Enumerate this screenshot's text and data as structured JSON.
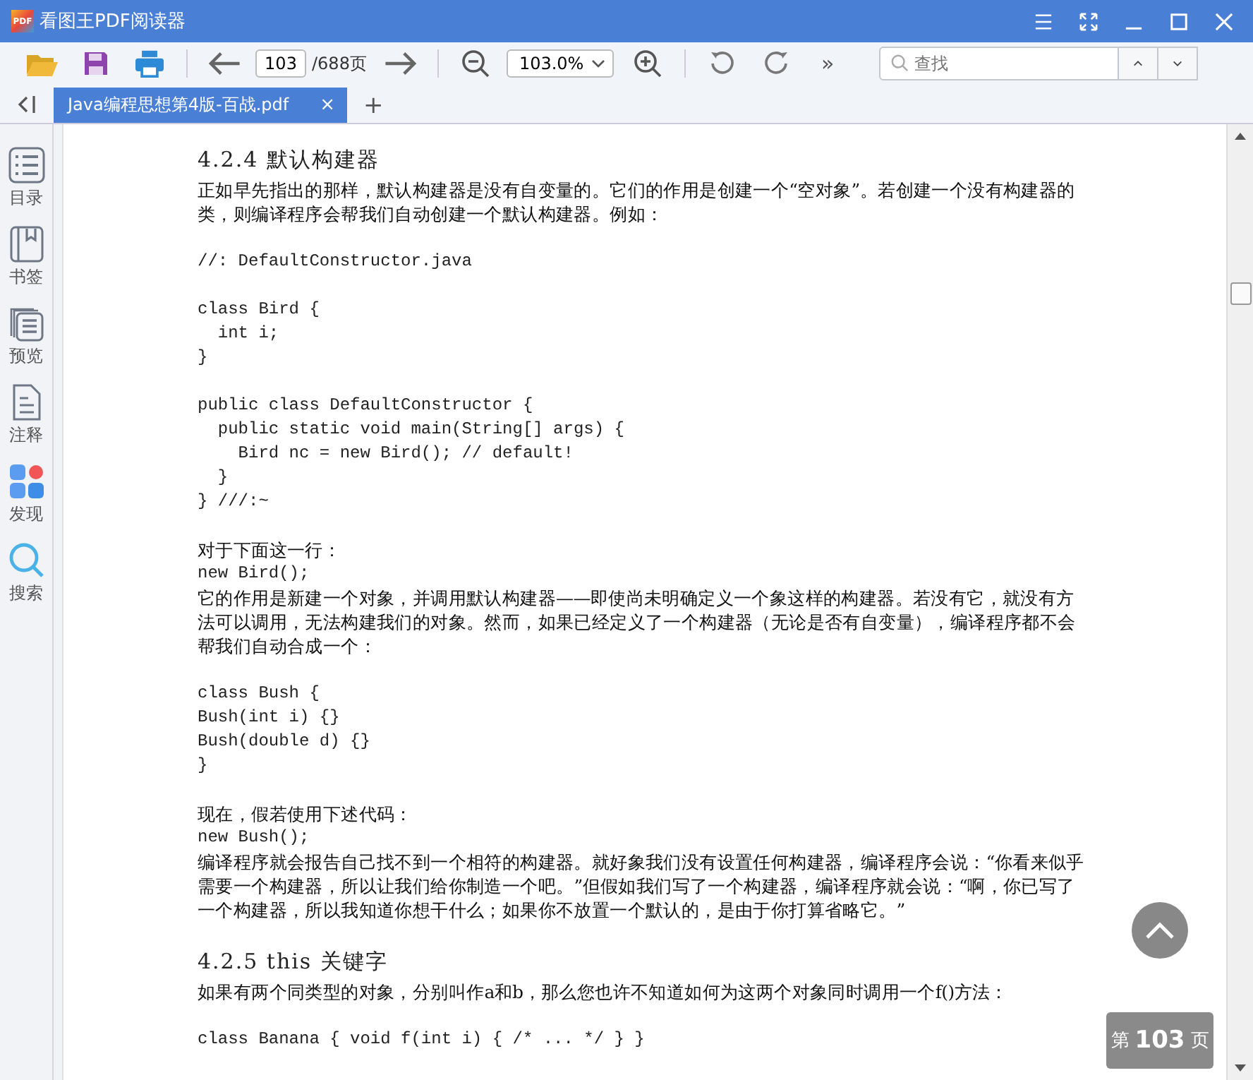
{
  "window": {
    "logo_text": "PDF",
    "title": "看图王PDF阅读器"
  },
  "toolbar": {
    "page_input": "103",
    "page_total": "/688页",
    "zoom": "103.0%",
    "more": "»",
    "search": {
      "placeholder": "查找"
    }
  },
  "tabs": [
    {
      "label": "Java编程思想第4版-百战.pdf",
      "selected": true,
      "close": "×"
    }
  ],
  "add_tab": "+",
  "sidebar": [
    {
      "kind": "toc",
      "label": "目录"
    },
    {
      "kind": "bookmark",
      "label": "书签"
    },
    {
      "kind": "preview",
      "label": "预览"
    },
    {
      "kind": "note",
      "label": "注释"
    },
    {
      "kind": "discover",
      "label": "发现"
    },
    {
      "kind": "search",
      "label": "搜索"
    }
  ],
  "document": {
    "sections": [
      [
        {
          "kind": "heading",
          "text": "4.2.4  默认构建器"
        },
        {
          "kind": "para",
          "text": "正如早先指出的那样，默认构建器是没有自变量的。它们的作用是创建一个“空对象”。若创建一个没有构建器的类，则编译程序会帮我们自动创建一个默认构建器。例如："
        }
      ],
      [
        {
          "kind": "code",
          "text": "//: DefaultConstructor.java"
        }
      ],
      [
        {
          "kind": "code",
          "text": "class Bird {\n  int i;\n}"
        }
      ],
      [
        {
          "kind": "code",
          "text": "public class DefaultConstructor {\n  public static void main(String[] args) {\n    Bird nc = new Bird(); // default!\n  }\n} ///:~"
        }
      ],
      [
        {
          "kind": "para",
          "text": "对于下面这一行："
        },
        {
          "kind": "code",
          "text": "new Bird();"
        },
        {
          "kind": "para",
          "text": "它的作用是新建一个对象，并调用默认构建器——即使尚未明确定义一个象这样的构建器。若没有它，就没有方法可以调用，无法构建我们的对象。然而，如果已经定义了一个构建器（无论是否有自变量），编译程序都不会帮我们自动合成一个："
        }
      ],
      [
        {
          "kind": "code",
          "text": "class Bush {\nBush(int i) {}\nBush(double d) {}\n}"
        }
      ],
      [
        {
          "kind": "para",
          "text": "现在，假若使用下述代码："
        },
        {
          "kind": "code",
          "text": "new Bush();"
        },
        {
          "kind": "para",
          "text": "编译程序就会报告自己找不到一个相符的构建器。就好象我们没有设置任何构建器，编译程序会说：“你看来似乎需要一个构建器，所以让我们给你制造一个吧。”但假如我们写了一个构建器，编译程序就会说：“啊，你已写了一个构建器，所以我知道你想干什么；如果你不放置一个默认的，是由于你打算省略它。”"
        }
      ],
      [
        {
          "kind": "heading",
          "text": "4.2.5  this 关键字"
        },
        {
          "kind": "para",
          "text": "如果有两个同类型的对象，分别叫作a和b，那么您也许不知道如何为这两个对象同时调用一个f()方法："
        }
      ],
      [
        {
          "kind": "code",
          "text": "class Banana { void f(int i) { /* ... */ } }"
        }
      ]
    ]
  },
  "page_badge": {
    "prefix": "第",
    "number": "103",
    "suffix": "页"
  }
}
